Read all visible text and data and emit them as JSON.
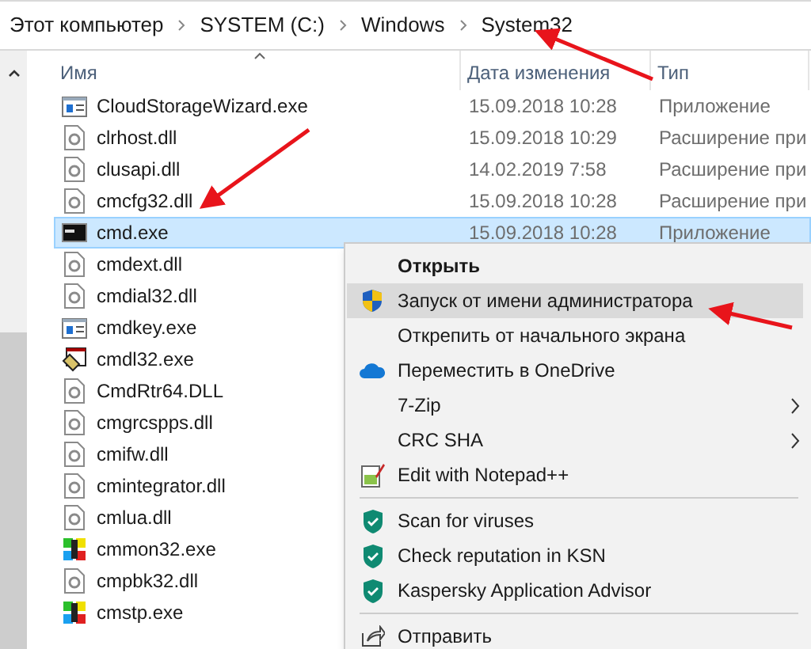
{
  "breadcrumb": [
    "Этот компьютер",
    "SYSTEM (C:)",
    "Windows",
    "System32"
  ],
  "columns": [
    {
      "label": "Имя",
      "sorted": true
    },
    {
      "label": "Дата изменения",
      "sorted": false
    },
    {
      "label": "Тип",
      "sorted": false
    }
  ],
  "rows": [
    {
      "name": "CloudStorageWizard.exe",
      "date": "15.09.2018 10:28",
      "type": "Приложение",
      "kind": "window",
      "selected": false
    },
    {
      "name": "clrhost.dll",
      "date": "15.09.2018 10:29",
      "type": "Расширение при",
      "kind": "dll",
      "selected": false
    },
    {
      "name": "clusapi.dll",
      "date": "14.02.2019 7:58",
      "type": "Расширение при",
      "kind": "dll",
      "selected": false
    },
    {
      "name": "cmcfg32.dll",
      "date": "15.09.2018 10:28",
      "type": "Расширение при",
      "kind": "dll",
      "selected": false
    },
    {
      "name": "cmd.exe",
      "date": "15.09.2018 10:28",
      "type": "Приложение",
      "kind": "console",
      "selected": true
    },
    {
      "name": "cmdext.dll",
      "kind": "dll",
      "selected": false
    },
    {
      "name": "cmdial32.dll",
      "kind": "dll",
      "selected": false
    },
    {
      "name": "cmdkey.exe",
      "kind": "window",
      "selected": false
    },
    {
      "name": "cmdl32.exe",
      "kind": "setup",
      "selected": false
    },
    {
      "name": "CmdRtr64.DLL",
      "kind": "dll",
      "selected": false
    },
    {
      "name": "cmgrcspps.dll",
      "kind": "dll",
      "selected": false
    },
    {
      "name": "cmifw.dll",
      "kind": "dll",
      "selected": false
    },
    {
      "name": "cmintegrator.dll",
      "kind": "dll",
      "selected": false
    },
    {
      "name": "cmlua.dll",
      "kind": "dll",
      "selected": false
    },
    {
      "name": "cmmon32.exe",
      "kind": "colorful",
      "selected": false
    },
    {
      "name": "cmpbk32.dll",
      "kind": "dll",
      "selected": false
    },
    {
      "name": "cmstp.exe",
      "kind": "colorful",
      "selected": false
    }
  ],
  "context_menu": [
    {
      "kind": "plain",
      "label": "Открыть",
      "bold": true,
      "selected": false
    },
    {
      "kind": "shield",
      "label": "Запуск от имени администратора",
      "bold": false,
      "selected": true
    },
    {
      "kind": "plain",
      "label": "Открепить от начального экрана",
      "bold": false,
      "selected": false
    },
    {
      "kind": "cloud",
      "label": "Переместить в OneDrive",
      "bold": false,
      "selected": false
    },
    {
      "kind": "submenu",
      "label": "7-Zip",
      "bold": false,
      "selected": false
    },
    {
      "kind": "submenu",
      "label": "CRC SHA",
      "bold": false,
      "selected": false
    },
    {
      "kind": "notepad",
      "label": "Edit with Notepad++",
      "bold": false,
      "selected": false
    },
    {
      "kind": "separator"
    },
    {
      "kind": "kshield",
      "label": "Scan for viruses",
      "bold": false,
      "selected": false
    },
    {
      "kind": "kshield",
      "label": "Check reputation in KSN",
      "bold": false,
      "selected": false
    },
    {
      "kind": "kshield",
      "label": "Kaspersky Application Advisor",
      "bold": false,
      "selected": false
    },
    {
      "kind": "separator"
    },
    {
      "kind": "share",
      "label": "Отправить",
      "bold": false,
      "selected": false
    }
  ]
}
